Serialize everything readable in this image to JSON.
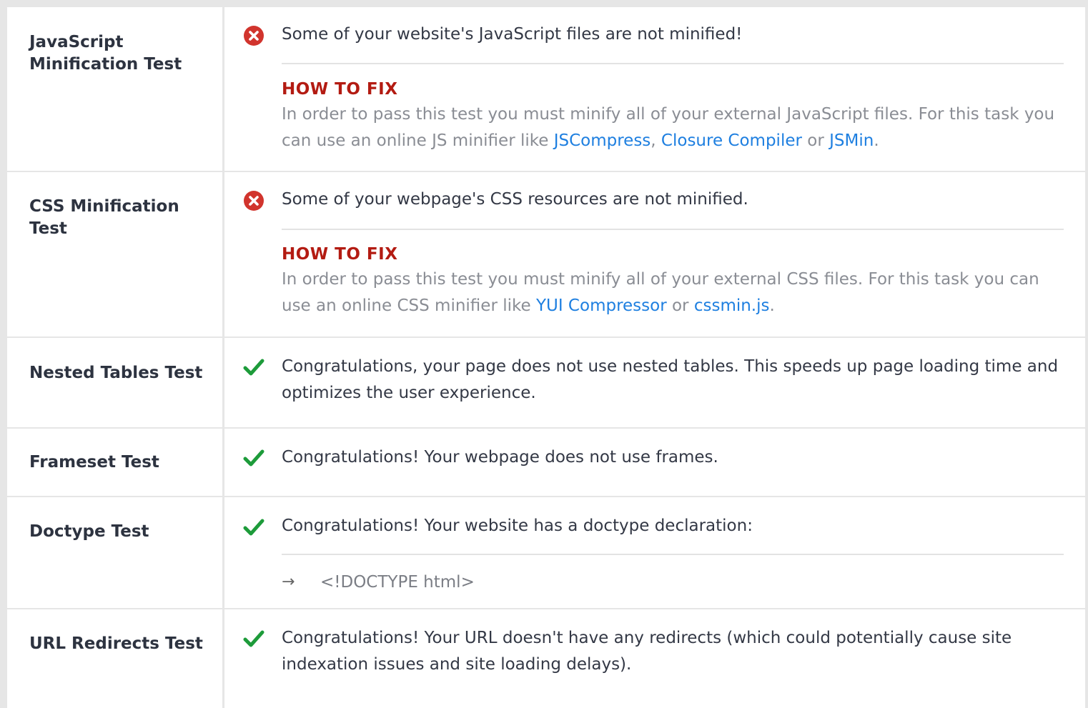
{
  "colors": {
    "fail": "#d1342d",
    "pass": "#1d9b3a",
    "fix_title": "#b31b12",
    "link": "#1e7fe0"
  },
  "tests": [
    {
      "name": "JavaScript Minification Test",
      "status": "fail",
      "status_icon": "error-circle-icon",
      "message": "Some of your website's JavaScript files are not minified!",
      "fix_title": "HOW TO FIX",
      "fix_prefix": "In order to pass this test you must minify all of your external JavaScript files. For this task you can use an online JS minifier like ",
      "links": [
        "JSCompress",
        "Closure Compiler",
        "JSMin"
      ],
      "sep1": ", ",
      "sep2": " or ",
      "end": "."
    },
    {
      "name": "CSS Minification Test",
      "status": "fail",
      "status_icon": "error-circle-icon",
      "message": "Some of your webpage's CSS resources are not minified.",
      "fix_title": "HOW TO FIX",
      "fix_prefix": "In order to pass this test you must minify all of your external CSS files. For this task you can use an online CSS minifier like ",
      "links": [
        "YUI Compressor",
        "cssmin.js"
      ],
      "sep1": " or ",
      "end": "."
    },
    {
      "name": "Nested Tables Test",
      "status": "pass",
      "status_icon": "checkmark-icon",
      "message": "Congratulations, your page does not use nested tables. This speeds up page loading time and optimizes the user experience."
    },
    {
      "name": "Frameset Test",
      "status": "pass",
      "status_icon": "checkmark-icon",
      "message": "Congratulations! Your webpage does not use frames."
    },
    {
      "name": "Doctype Test",
      "status": "pass",
      "status_icon": "checkmark-icon",
      "message": "Congratulations! Your website has a doctype declaration:",
      "detail_icon": "arrow-right-icon",
      "detail": "<!DOCTYPE html>"
    },
    {
      "name": "URL Redirects Test",
      "status": "pass",
      "status_icon": "checkmark-icon",
      "message": "Congratulations! Your URL doesn't have any redirects (which could potentially cause site indexation issues and site loading delays)."
    }
  ]
}
